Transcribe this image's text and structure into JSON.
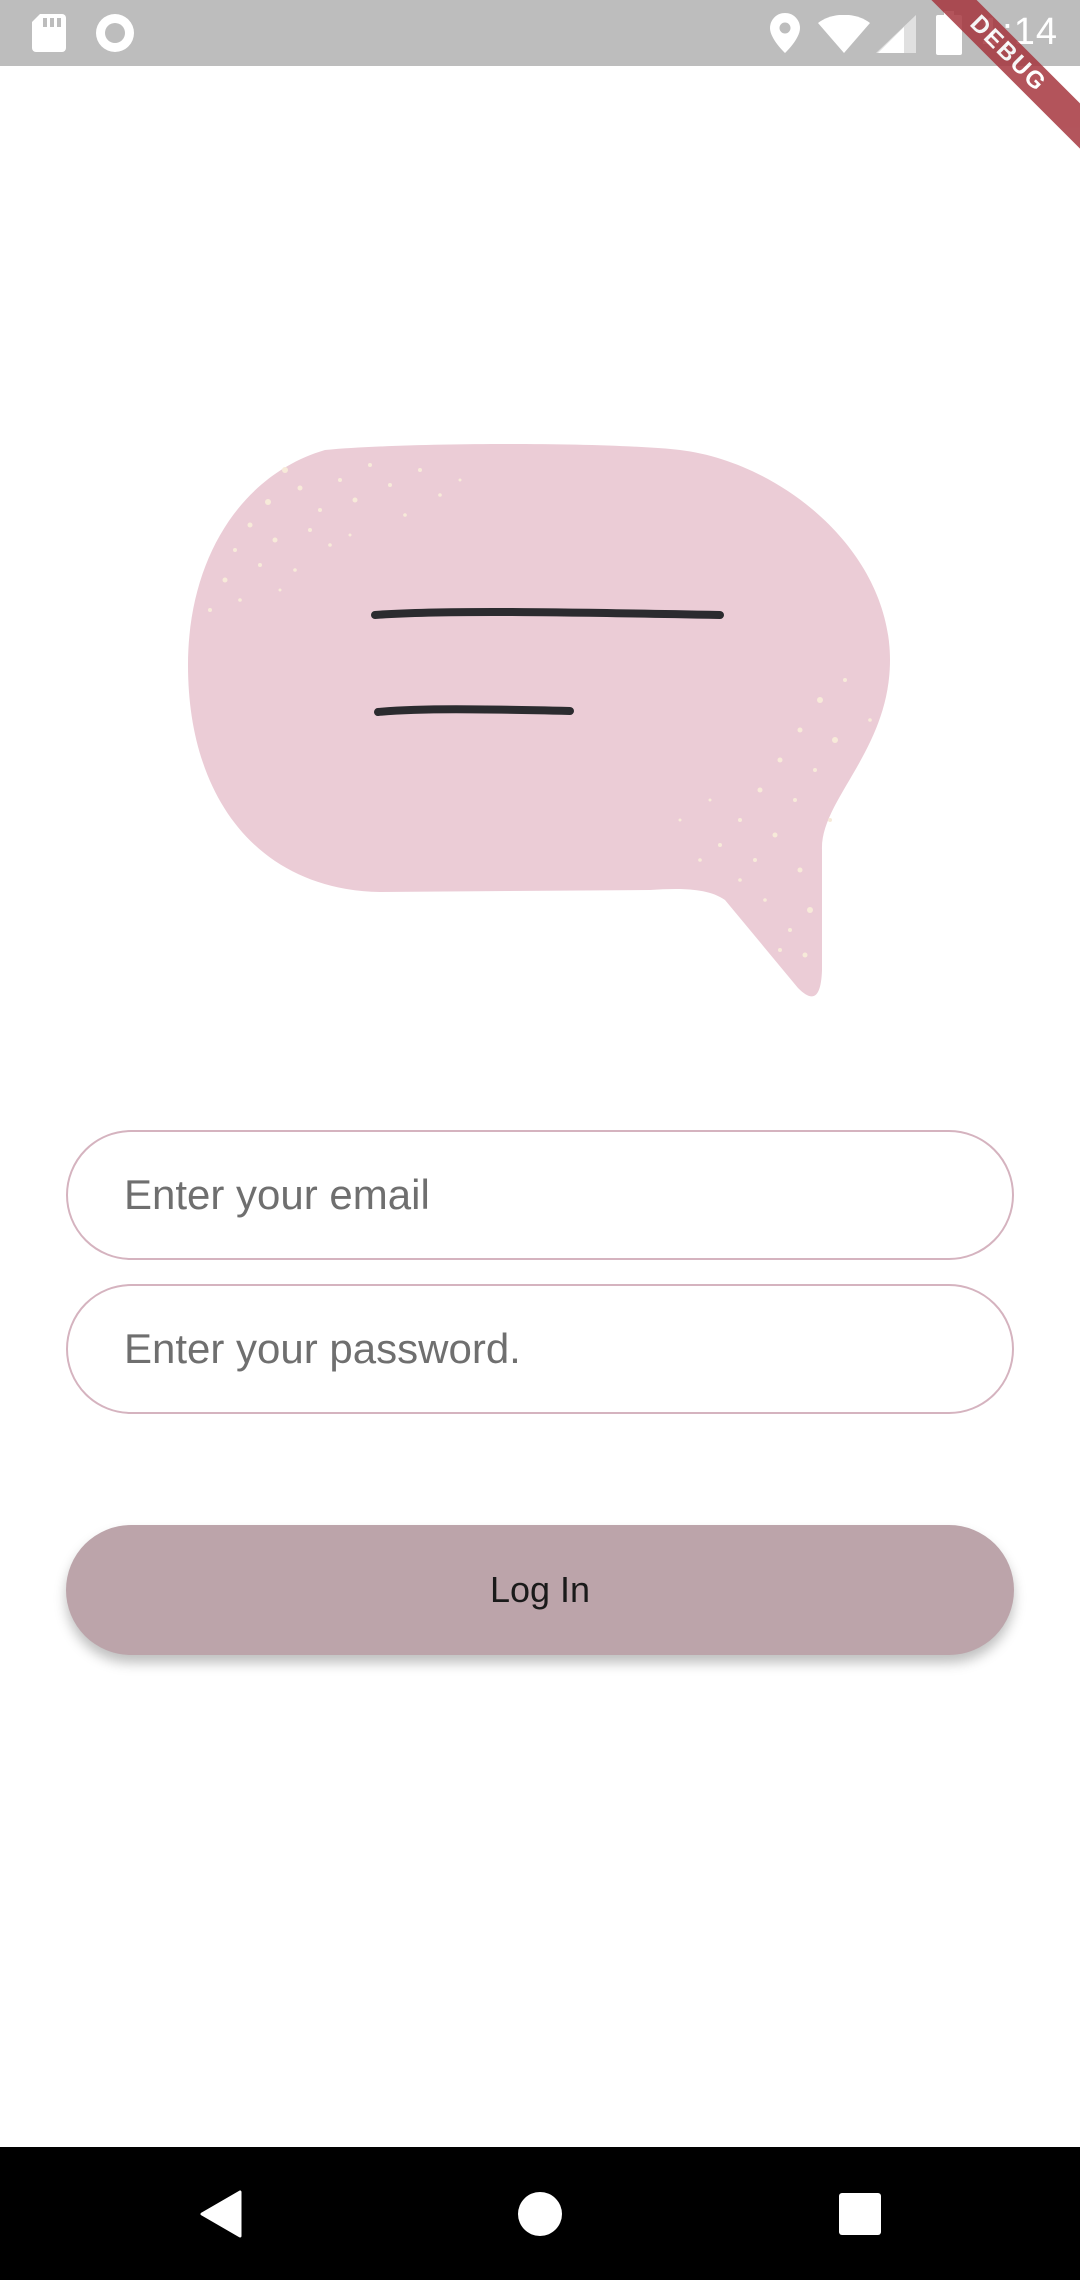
{
  "status_bar": {
    "time": "1:14",
    "icons": [
      "sd-card-icon",
      "record-icon",
      "location-icon",
      "wifi-icon",
      "cellular-signal-icon",
      "battery-icon"
    ]
  },
  "debug_banner": {
    "label": "DEBUG",
    "color": "#a6373f"
  },
  "illustration": {
    "icon": "speech-bubble-icon",
    "fill_color": "#ebccd6",
    "speckle_color": "#f7ead9"
  },
  "login_form": {
    "email_placeholder": "Enter your email",
    "password_placeholder": "Enter your password.",
    "login_label": "Log In",
    "field_border_color": "#d5b3bf",
    "button_color": "#bca4aa"
  },
  "nav_bar": {
    "buttons": [
      "back-icon",
      "home-icon",
      "recents-icon"
    ]
  }
}
